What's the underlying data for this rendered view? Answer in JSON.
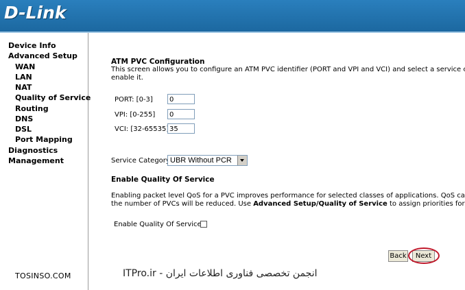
{
  "brand": {
    "logo_text": "D-Link"
  },
  "sidebar": {
    "items": [
      {
        "label": "Device Info",
        "level": "top"
      },
      {
        "label": "Advanced Setup",
        "level": "top"
      },
      {
        "label": "WAN",
        "level": "sub"
      },
      {
        "label": "LAN",
        "level": "sub"
      },
      {
        "label": "NAT",
        "level": "sub"
      },
      {
        "label": "Quality of Service",
        "level": "sub"
      },
      {
        "label": "Routing",
        "level": "sub"
      },
      {
        "label": "DNS",
        "level": "sub"
      },
      {
        "label": "DSL",
        "level": "sub"
      },
      {
        "label": "Port Mapping",
        "level": "sub"
      },
      {
        "label": "Diagnostics",
        "level": "top"
      },
      {
        "label": "Management",
        "level": "top"
      }
    ],
    "footer_text": "TOSINSO.COM"
  },
  "main": {
    "atm_title": "ATM PVC Configuration",
    "atm_desc_line1": "This screen allows you to configure an ATM PVC identifier (PORT and VPI and VCI) and select a service catego",
    "atm_desc_line2": "enable it.",
    "port_label": "PORT: [0-3]",
    "port_value": "0",
    "vpi_label": "VPI: [0-255]",
    "vpi_value": "0",
    "vci_label": "VCI: [32-65535]",
    "vci_value": "35",
    "service_category_label": "Service Category:",
    "service_category_value": "UBR Without PCR",
    "qos_title": "Enable Quality Of Service",
    "qos_desc_line1": "Enabling packet level QoS for a PVC improves performance for selected classes of applications.  QoS cannot be",
    "qos_desc_line2_pre": "the number of PVCs will be reduced. Use ",
    "qos_desc_line2_bold": "Advanced Setup/Quality of Service",
    "qos_desc_line2_post": " to assign priorities for the ap",
    "qos_checkbox_label": "Enable Quality Of Service",
    "back_label": "Back",
    "next_label": "Next",
    "watermark": "ITPro.ir - انجمن تخصصی فناوری اطلاعات ایران"
  },
  "colors": {
    "header": "#1f6fa8",
    "highlight_circle": "#c0182a"
  }
}
